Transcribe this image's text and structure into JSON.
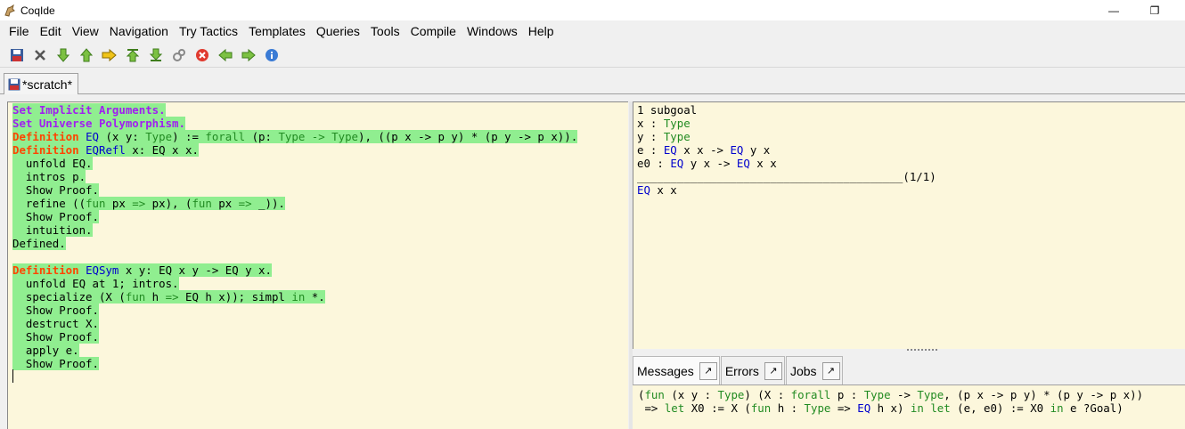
{
  "window": {
    "title": "CoqIde",
    "minimize": "—",
    "restore": "❐"
  },
  "menu": [
    "File",
    "Edit",
    "View",
    "Navigation",
    "Try Tactics",
    "Templates",
    "Queries",
    "Tools",
    "Compile",
    "Windows",
    "Help"
  ],
  "toolbar": {
    "icons": [
      "save-icon",
      "close-icon",
      "forward-one-icon",
      "backward-one-icon",
      "go-to-cursor-icon",
      "go-to-start-icon",
      "go-to-end-icon",
      "fully-check-icon",
      "interrupt-icon",
      "previous-occurrence-icon",
      "next-occurrence-icon",
      "about-icon"
    ]
  },
  "tab": {
    "label": "*scratch*"
  },
  "editor": {
    "lines": [
      [
        [
          "kw1",
          "Set Implicit Arguments."
        ]
      ],
      [
        [
          "kw1",
          "Set Universe Polymorphism."
        ]
      ],
      [
        [
          "kw2",
          "Definition"
        ],
        [
          "",
          " "
        ],
        [
          "id",
          "EQ"
        ],
        [
          "",
          " (x y: "
        ],
        [
          "ty",
          "Type"
        ],
        [
          "",
          ") := "
        ],
        [
          "ty",
          "forall"
        ],
        [
          "",
          " (p: "
        ],
        [
          "ty",
          "Type"
        ],
        [
          "",
          " "
        ],
        [
          "ty",
          "->"
        ],
        [
          "",
          " "
        ],
        [
          "ty",
          "Type"
        ],
        [
          "",
          "), ((p x -> p y) * (p y -> p x))."
        ]
      ],
      [
        [
          "kw2",
          "Definition"
        ],
        [
          "",
          " "
        ],
        [
          "id",
          "EQRefl"
        ],
        [
          "",
          " x: EQ x x."
        ]
      ],
      [
        [
          "",
          "  unfold EQ."
        ]
      ],
      [
        [
          "",
          "  intros p."
        ]
      ],
      [
        [
          "",
          "  Show Proof."
        ]
      ],
      [
        [
          "",
          "  refine (("
        ],
        [
          "ty",
          "fun"
        ],
        [
          "",
          " px "
        ],
        [
          "ty",
          "=>"
        ],
        [
          "",
          " px), ("
        ],
        [
          "ty",
          "fun"
        ],
        [
          "",
          " px "
        ],
        [
          "ty",
          "=>"
        ],
        [
          "",
          " _))."
        ]
      ],
      [
        [
          "",
          "  Show Proof."
        ]
      ],
      [
        [
          "",
          "  intuition."
        ]
      ],
      [
        [
          "",
          "Defined."
        ]
      ],
      [],
      [
        [
          "kw2",
          "Definition"
        ],
        [
          "",
          " "
        ],
        [
          "id",
          "EQSym"
        ],
        [
          "",
          " x y: EQ x y -> EQ y x."
        ]
      ],
      [
        [
          "",
          "  unfold EQ at 1; intros."
        ]
      ],
      [
        [
          "",
          "  specialize (X ("
        ],
        [
          "ty",
          "fun"
        ],
        [
          "",
          " h "
        ],
        [
          "ty",
          "=>"
        ],
        [
          "",
          " EQ h x)); simpl "
        ],
        [
          "ty",
          "in"
        ],
        [
          "",
          " *."
        ]
      ],
      [
        [
          "",
          "  Show Proof."
        ]
      ],
      [
        [
          "",
          "  destruct X."
        ]
      ],
      [
        [
          "",
          "  Show Proof."
        ]
      ],
      [
        [
          "",
          "  apply e."
        ]
      ],
      [
        [
          "",
          "  Show Proof."
        ]
      ]
    ]
  },
  "goals": {
    "lines": [
      [
        [
          "",
          "1 subgoal"
        ]
      ],
      [
        [
          "",
          "x : "
        ],
        [
          "ty",
          "Type"
        ]
      ],
      [
        [
          "",
          "y : "
        ],
        [
          "ty",
          "Type"
        ]
      ],
      [
        [
          "",
          "e : "
        ],
        [
          "id",
          "EQ"
        ],
        [
          "",
          " x x -> "
        ],
        [
          "id",
          "EQ"
        ],
        [
          "",
          " y x"
        ]
      ],
      [
        [
          "",
          "e0 : "
        ],
        [
          "id",
          "EQ"
        ],
        [
          "",
          " y x -> "
        ],
        [
          "id",
          "EQ"
        ],
        [
          "",
          " x x"
        ]
      ],
      [
        [
          "",
          "________________________________________(1/1)"
        ]
      ],
      [
        [
          "id",
          "EQ"
        ],
        [
          "",
          " x x"
        ]
      ]
    ]
  },
  "panel_tabs": [
    {
      "label": "Messages",
      "detach": "↗"
    },
    {
      "label": "Errors",
      "detach": "↗"
    },
    {
      "label": "Jobs",
      "detach": "↗"
    }
  ],
  "messages": {
    "lines": [
      [
        [
          "",
          "("
        ],
        [
          "ty",
          "fun"
        ],
        [
          "",
          " (x y : "
        ],
        [
          "ty",
          "Type"
        ],
        [
          "",
          ") (X : "
        ],
        [
          "ty",
          "forall"
        ],
        [
          "",
          " p : "
        ],
        [
          "ty",
          "Type"
        ],
        [
          "",
          " -> "
        ],
        [
          "ty",
          "Type"
        ],
        [
          "",
          ", (p x -> p y) * (p y -> p x))"
        ]
      ],
      [
        [
          "",
          " => "
        ],
        [
          "ty",
          "let"
        ],
        [
          "",
          " X0 := X ("
        ],
        [
          "ty",
          "fun"
        ],
        [
          "",
          " h : "
        ],
        [
          "ty",
          "Type"
        ],
        [
          "",
          " => "
        ],
        [
          "id",
          "EQ"
        ],
        [
          "",
          " h x) "
        ],
        [
          "ty",
          "in"
        ],
        [
          "",
          " "
        ],
        [
          "ty",
          "let"
        ],
        [
          "",
          " (e, e0) := X0 "
        ],
        [
          "ty",
          "in"
        ],
        [
          "",
          " e ?Goal)"
        ]
      ]
    ]
  },
  "colors": {
    "editor_bg": "#fcf7dc",
    "processed_bg": "#90ee90",
    "keyword": "#a020f0",
    "vernac": "#ff4500",
    "type": "#228b22",
    "ident": "#0000cd"
  }
}
